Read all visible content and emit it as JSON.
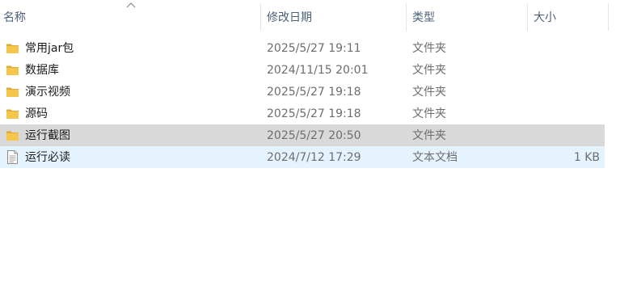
{
  "columns": {
    "name": "名称",
    "date": "修改日期",
    "type": "类型",
    "size": "大小"
  },
  "files": [
    {
      "name": "常用jar包",
      "date": "2025/5/27 19:11",
      "type": "文件夹",
      "size": "",
      "icon": "folder-icon"
    },
    {
      "name": "数据库",
      "date": "2024/11/15 20:01",
      "type": "文件夹",
      "size": "",
      "icon": "folder-icon"
    },
    {
      "name": "演示视频",
      "date": "2025/5/27 19:18",
      "type": "文件夹",
      "size": "",
      "icon": "folder-icon"
    },
    {
      "name": "源码",
      "date": "2025/5/27 19:18",
      "type": "文件夹",
      "size": "",
      "icon": "folder-icon"
    },
    {
      "name": "运行截图",
      "date": "2025/5/27 20:50",
      "type": "文件夹",
      "size": "",
      "icon": "folder-icon",
      "state": "selected"
    },
    {
      "name": "运行必读",
      "date": "2024/7/12 17:29",
      "type": "文本文档",
      "size": "1 KB",
      "icon": "text-document-icon",
      "state": "hover"
    }
  ],
  "colors": {
    "folder": "#f4c64c",
    "folder_dark": "#e2a93a",
    "selected_bg": "#d9d9d9",
    "hover_bg": "#e5f3ff",
    "header_text": "#4c607a"
  }
}
